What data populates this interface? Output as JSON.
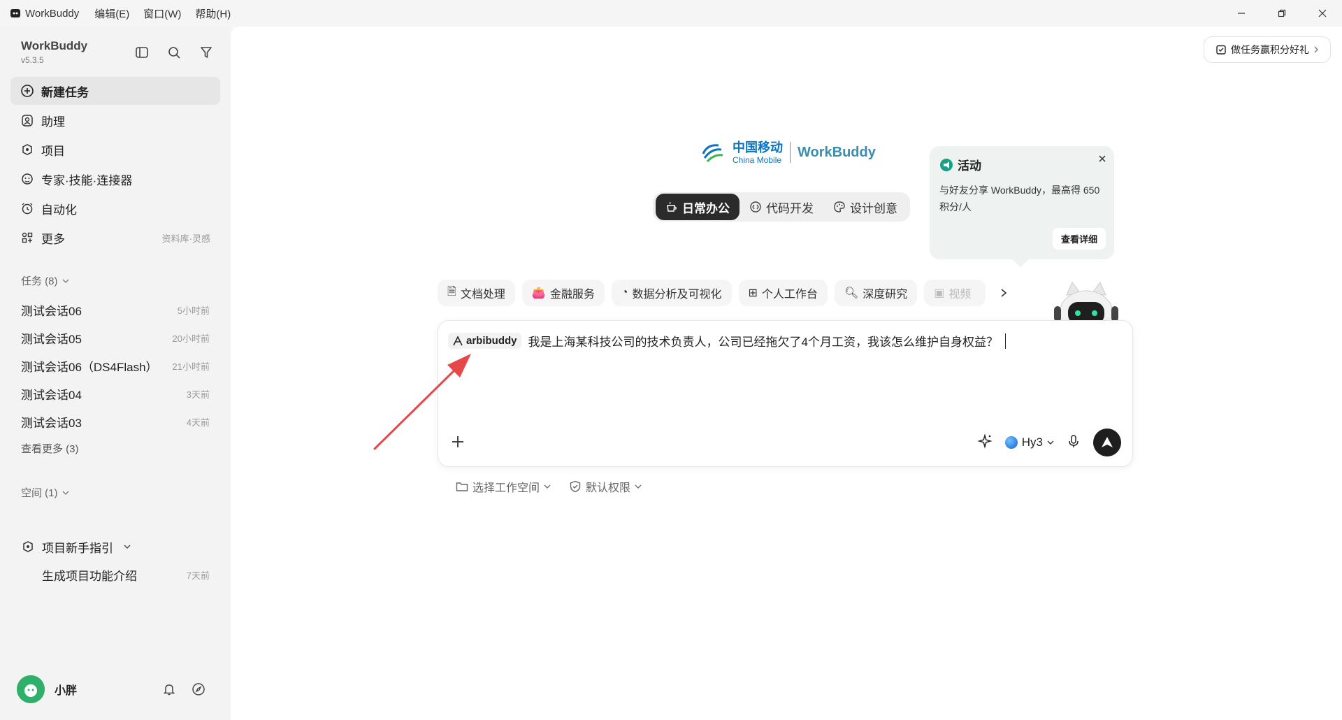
{
  "titlebar": {
    "app_name": "WorkBuddy",
    "menus": [
      "编辑(E)",
      "窗口(W)",
      "帮助(H)"
    ]
  },
  "sidebar": {
    "brand": "WorkBuddy",
    "version": "v5.3.5",
    "nav": [
      {
        "label": "新建任务",
        "icon": "plus-circle-icon",
        "active": true
      },
      {
        "label": "助理",
        "icon": "assistant-icon"
      },
      {
        "label": "项目",
        "icon": "project-icon"
      },
      {
        "label": "专家·技能·连接器",
        "icon": "expert-icon"
      },
      {
        "label": "自动化",
        "icon": "alarm-icon"
      },
      {
        "label": "更多",
        "icon": "grid-icon",
        "hint": "资料库·灵感"
      }
    ],
    "tasks_header": "任务 (8)",
    "tasks": [
      {
        "name": "测试会话06",
        "time": "5小时前"
      },
      {
        "name": "测试会话05",
        "time": "20小时前"
      },
      {
        "name": "测试会话06（DS4Flash）",
        "time": "21小时前"
      },
      {
        "name": "测试会话04",
        "time": "3天前"
      },
      {
        "name": "测试会话03",
        "time": "4天前"
      }
    ],
    "see_more": "查看更多 (3)",
    "spaces_header": "空间 (1)",
    "project": {
      "name": "项目新手指引",
      "child": "生成项目功能介绍",
      "child_time": "7天前"
    },
    "user": {
      "name": "小胖"
    }
  },
  "main": {
    "promo_label": "做任务赢积分好礼",
    "logo": {
      "cm_cn": "中国移动",
      "cm_en": "China Mobile",
      "product": "WorkBuddy"
    },
    "modes": [
      "日常办公",
      "代码开发",
      "设计创意"
    ],
    "popover": {
      "title": "活动",
      "content": "与好友分享 WorkBuddy，最高得 650 积分/人",
      "button": "查看详细"
    },
    "skills": [
      "文档处理",
      "金融服务",
      "数据分析及可视化",
      "个人工作台",
      "深度研究",
      "视频"
    ],
    "composer": {
      "agent_chip": "arbibuddy",
      "text": "我是上海某科技公司的技术负责人，公司已经拖欠了4个月工资，我该怎么维护自身权益？",
      "model": "Hy3"
    },
    "workspace_label": "选择工作空间",
    "permission_label": "默认权限"
  },
  "colors": {
    "accent_arrow": "#e8474a",
    "brand_blue": "#0a74c2"
  }
}
